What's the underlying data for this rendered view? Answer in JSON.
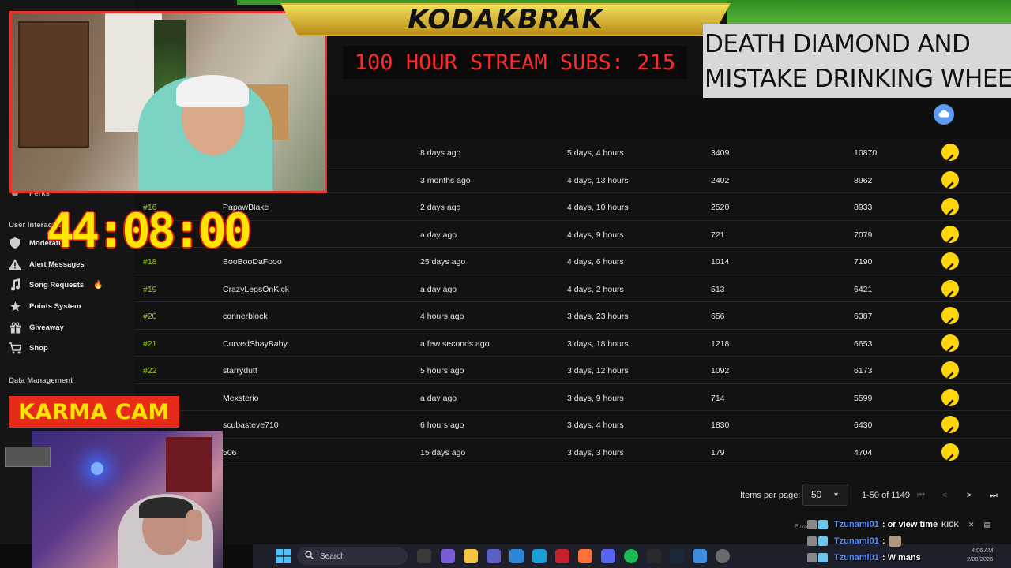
{
  "sidebar": {
    "partial_item": "Perks",
    "sections": {
      "user_interactions": "User Interactions",
      "data_management": "Data Management"
    },
    "items": [
      {
        "label": "Moderation",
        "icon": "shield-icon"
      },
      {
        "label": "Alert Messages",
        "icon": "warning-icon"
      },
      {
        "label": "Song Requests",
        "icon": "music-note-icon",
        "badge": "fire-icon"
      },
      {
        "label": "Points System",
        "icon": "star-icon"
      },
      {
        "label": "Giveaway",
        "icon": "gift-icon"
      },
      {
        "label": "Shop",
        "icon": "cart-icon"
      }
    ]
  },
  "table": {
    "rows": [
      {
        "rank": "",
        "user": "",
        "last_seen": "8 days ago",
        "watch_time": "5 days, 4 hours",
        "messages": "3409",
        "points": "10870"
      },
      {
        "rank": "",
        "user": "",
        "last_seen": "3 months ago",
        "watch_time": "4 days, 13 hours",
        "messages": "2402",
        "points": "8962"
      },
      {
        "rank": "#16",
        "user": "PapawBlake",
        "last_seen": "2 days ago",
        "watch_time": "4 days, 10 hours",
        "messages": "2520",
        "points": "8933"
      },
      {
        "rank": "",
        "user": "",
        "last_seen": "a day ago",
        "watch_time": "4 days, 9 hours",
        "messages": "721",
        "points": "7079"
      },
      {
        "rank": "#18",
        "user": "BooBooDaFooo",
        "last_seen": "25 days ago",
        "watch_time": "4 days, 6 hours",
        "messages": "1014",
        "points": "7190"
      },
      {
        "rank": "#19",
        "user": "CrazyLegsOnKick",
        "last_seen": "a day ago",
        "watch_time": "4 days, 2 hours",
        "messages": "513",
        "points": "6421"
      },
      {
        "rank": "#20",
        "user": "connerblock",
        "last_seen": "4 hours ago",
        "watch_time": "3 days, 23 hours",
        "messages": "656",
        "points": "6387"
      },
      {
        "rank": "#21",
        "user": "CurvedShayBaby",
        "last_seen": "a few seconds ago",
        "watch_time": "3 days, 18 hours",
        "messages": "1218",
        "points": "6653"
      },
      {
        "rank": "#22",
        "user": "starrydutt",
        "last_seen": "5 hours ago",
        "watch_time": "3 days, 12 hours",
        "messages": "1092",
        "points": "6173"
      },
      {
        "rank": "",
        "user": "Mexsterio",
        "last_seen": "a day ago",
        "watch_time": "3 days, 9 hours",
        "messages": "714",
        "points": "5599"
      },
      {
        "rank": "",
        "user": "scubasteve710",
        "last_seen": "6 hours ago",
        "watch_time": "3 days, 4 hours",
        "messages": "1830",
        "points": "6430"
      },
      {
        "rank": "",
        "user": "506",
        "last_seen": "15 days ago",
        "watch_time": "3 days, 3 hours",
        "messages": "179",
        "points": "4704"
      }
    ]
  },
  "pagination": {
    "items_per_page_label": "Items per page:",
    "items_per_page": "50",
    "range": "1-50 of 1149"
  },
  "overlay": {
    "channel_name": "KODAKBRAK",
    "subs_banner": "100 HOUR STREAM SUBS: 215",
    "wheel_line1": "DEATH DIAMOND AND",
    "wheel_line2": "MISTAKE DRINKING WHEEL",
    "timer": "44:08:00",
    "karma_cam_label": "KARMA CAM"
  },
  "chat": [
    {
      "user": "Tzunami01",
      "message": ": or view time"
    },
    {
      "user": "Tzunami01",
      "message": ":"
    },
    {
      "user": "Tzunami01",
      "message": ": W mans"
    }
  ],
  "taskbar": {
    "search_label": "Search",
    "time": "4:06 AM",
    "date": "2/28/2026"
  },
  "colors": {
    "accent_green": "#9bd400",
    "edit_yellow": "#ffd60a",
    "subs_red": "#ff2b2b",
    "timer_yellow": "#ffe600",
    "karma_red": "#e62b18",
    "chat_user_blue": "#4c8fff"
  }
}
